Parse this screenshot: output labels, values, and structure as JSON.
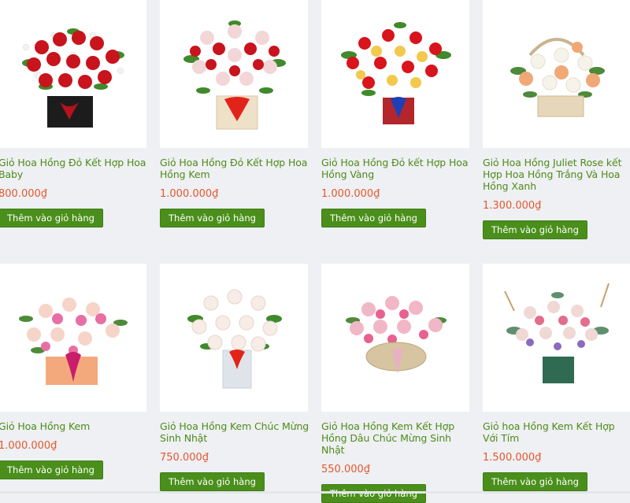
{
  "cart_button_label": "Thêm vào giỏ hàng",
  "products": [
    {
      "name": "Giỏ Hoa Hồng Đỏ Kết Hợp Hoa Baby",
      "price": "800.000₫",
      "image_icon": "red-rose-basket-image"
    },
    {
      "name": "Giỏ Hoa Hồng Đỏ Kết Hợp Hoa Hồng Kem",
      "price": "1.000.000₫",
      "image_icon": "red-cream-rose-basket-image"
    },
    {
      "name": "Giỏ Hoa Hồng Đỏ kết Hợp Hoa Hồng Vàng",
      "price": "1.000.000₫",
      "image_icon": "red-yellow-rose-basket-image"
    },
    {
      "name": "Giỏ Hoa Hồng Juliet Rose kết Hợp Hoa Hồng Trắng Và Hoa Hồng Xanh",
      "price": "1.300.000₫",
      "image_icon": "juliet-rose-basket-image"
    },
    {
      "name": "Giỏ Hoa Hồng Kem",
      "price": "1.000.000₫",
      "image_icon": "cream-rose-basket-image"
    },
    {
      "name": "Giỏ Hoa Hồng Kem Chúc Mừng Sinh Nhật",
      "price": "750.000₫",
      "image_icon": "white-rose-box-image"
    },
    {
      "name": "Giỏ Hoa Hồng Kem Kết Hợp Hồng Dâu Chúc Mừng Sinh Nhật",
      "price": "550.000₫",
      "image_icon": "pink-rose-wicker-basket-image"
    },
    {
      "name": "Giỏ hoa Hồng Kem Kết Hợp Với Tím",
      "price": "1.500.000₫",
      "image_icon": "cream-purple-flower-basket-image"
    }
  ]
}
